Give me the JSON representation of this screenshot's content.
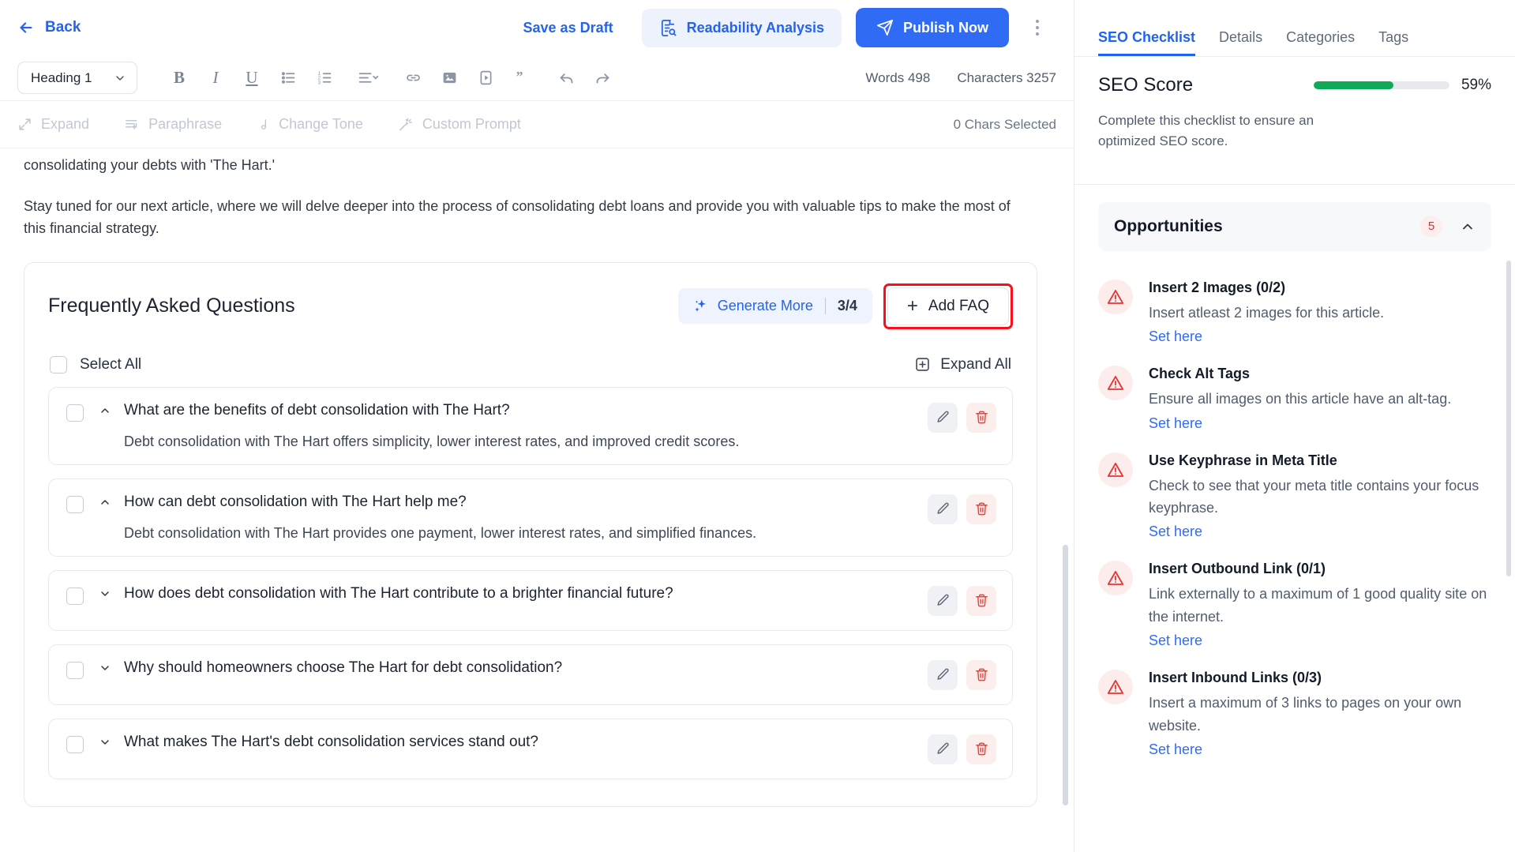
{
  "topbar": {
    "back_label": "Back",
    "back_icon": "arrow-left-icon",
    "save_draft_label": "Save as Draft",
    "readability_label": "Readability Analysis",
    "readability_icon": "document-search-icon",
    "publish_label": "Publish Now",
    "publish_icon": "send-icon",
    "publish_color": "#2f6bf5",
    "more_icon": "vertical-dots-icon"
  },
  "toolbar": {
    "heading_value": "Heading 1",
    "heading_chevron_icon": "chevron-down-icon",
    "icons": [
      {
        "name": "bold-icon",
        "glyph": "B"
      },
      {
        "name": "italic-icon",
        "glyph": "I"
      },
      {
        "name": "underline-icon",
        "glyph": "U"
      },
      {
        "name": "bullet-list-icon",
        "glyph": ""
      },
      {
        "name": "numbered-list-icon",
        "glyph": ""
      },
      {
        "name": "align-icon",
        "glyph": ""
      },
      {
        "name": "link-icon",
        "glyph": ""
      },
      {
        "name": "image-icon",
        "glyph": ""
      },
      {
        "name": "video-icon",
        "glyph": ""
      },
      {
        "name": "quote-icon",
        "glyph": ""
      },
      {
        "name": "undo-icon",
        "glyph": ""
      },
      {
        "name": "redo-icon",
        "glyph": ""
      }
    ],
    "words_label": "Words 498",
    "characters_label": "Characters 3257"
  },
  "ai_tools": {
    "items": [
      {
        "label": "Expand",
        "icon": "expand-arrows-icon"
      },
      {
        "label": "Paraphrase",
        "icon": "paraphrase-icon"
      },
      {
        "label": "Change Tone",
        "icon": "tone-icon"
      },
      {
        "label": "Custom Prompt",
        "icon": "magic-wand-icon"
      }
    ],
    "chars_selected": "0 Chars Selected"
  },
  "document": {
    "paragraphs": [
      "consolidating your debts with 'The Hart.'",
      "Stay tuned for our next article, where we will delve deeper into the process of consolidating debt loans and provide you with valuable tips to make the most of this financial strategy."
    ]
  },
  "faq": {
    "title": "Frequently Asked Questions",
    "generate_more_label": "Generate More",
    "generate_more_icon": "sparkles-icon",
    "generate_count": "3/4",
    "add_faq_label": "Add FAQ",
    "add_faq_icon": "plus-icon",
    "add_faq_highlight_color": "#fc0d1b",
    "select_all_label": "Select All",
    "expand_all_label": "Expand All",
    "expand_all_icon": "plus-square-icon",
    "edit_icon": "pencil-icon",
    "delete_icon": "trash-icon",
    "items": [
      {
        "question": "What are the benefits of debt consolidation with The Hart?",
        "answer": "Debt consolidation with The Hart offers simplicity, lower interest rates, and improved credit scores.",
        "expanded": true
      },
      {
        "question": "How can debt consolidation with The Hart help me?",
        "answer": "Debt consolidation with The Hart provides one payment, lower interest rates, and simplified finances.",
        "expanded": true
      },
      {
        "question": "How does debt consolidation with The Hart contribute to a brighter financial future?",
        "answer": "",
        "expanded": false
      },
      {
        "question": "Why should homeowners choose The Hart for debt consolidation?",
        "answer": "",
        "expanded": false
      },
      {
        "question": "What makes The Hart's debt consolidation services stand out?",
        "answer": "",
        "expanded": false
      }
    ]
  },
  "sidebar": {
    "tabs": [
      {
        "label": "SEO Checklist",
        "active": true
      },
      {
        "label": "Details",
        "active": false
      },
      {
        "label": "Categories",
        "active": false
      },
      {
        "label": "Tags",
        "active": false
      }
    ],
    "score_title": "SEO Score",
    "score_percent": "59%",
    "score_value": 59,
    "score_color": "#10a958",
    "score_desc": "Complete this checklist to ensure an optimized SEO score.",
    "opportunities_title": "Opportunities",
    "opportunities_count": "5",
    "opportunities_chevron_icon": "chevron-up-icon",
    "warning_icon": "warning-triangle-icon",
    "opportunities": [
      {
        "title": "Insert 2 Images (0/2)",
        "desc": "Insert atleast 2 images for this article.",
        "link": "Set here"
      },
      {
        "title": "Check Alt Tags",
        "desc": "Ensure all images on this article have an alt-tag.",
        "link": "Set here"
      },
      {
        "title": "Use Keyphrase in Meta Title",
        "desc": "Check to see that your meta title contains your focus keyphrase.",
        "link": "Set here"
      },
      {
        "title": "Insert Outbound Link (0/1)",
        "desc": "Link externally to a maximum of 1 good quality site on the internet.",
        "link": "Set here"
      },
      {
        "title": "Insert Inbound Links (0/3)",
        "desc": "Insert a maximum of 3 links to pages on your own website.",
        "link": "Set here"
      }
    ]
  }
}
